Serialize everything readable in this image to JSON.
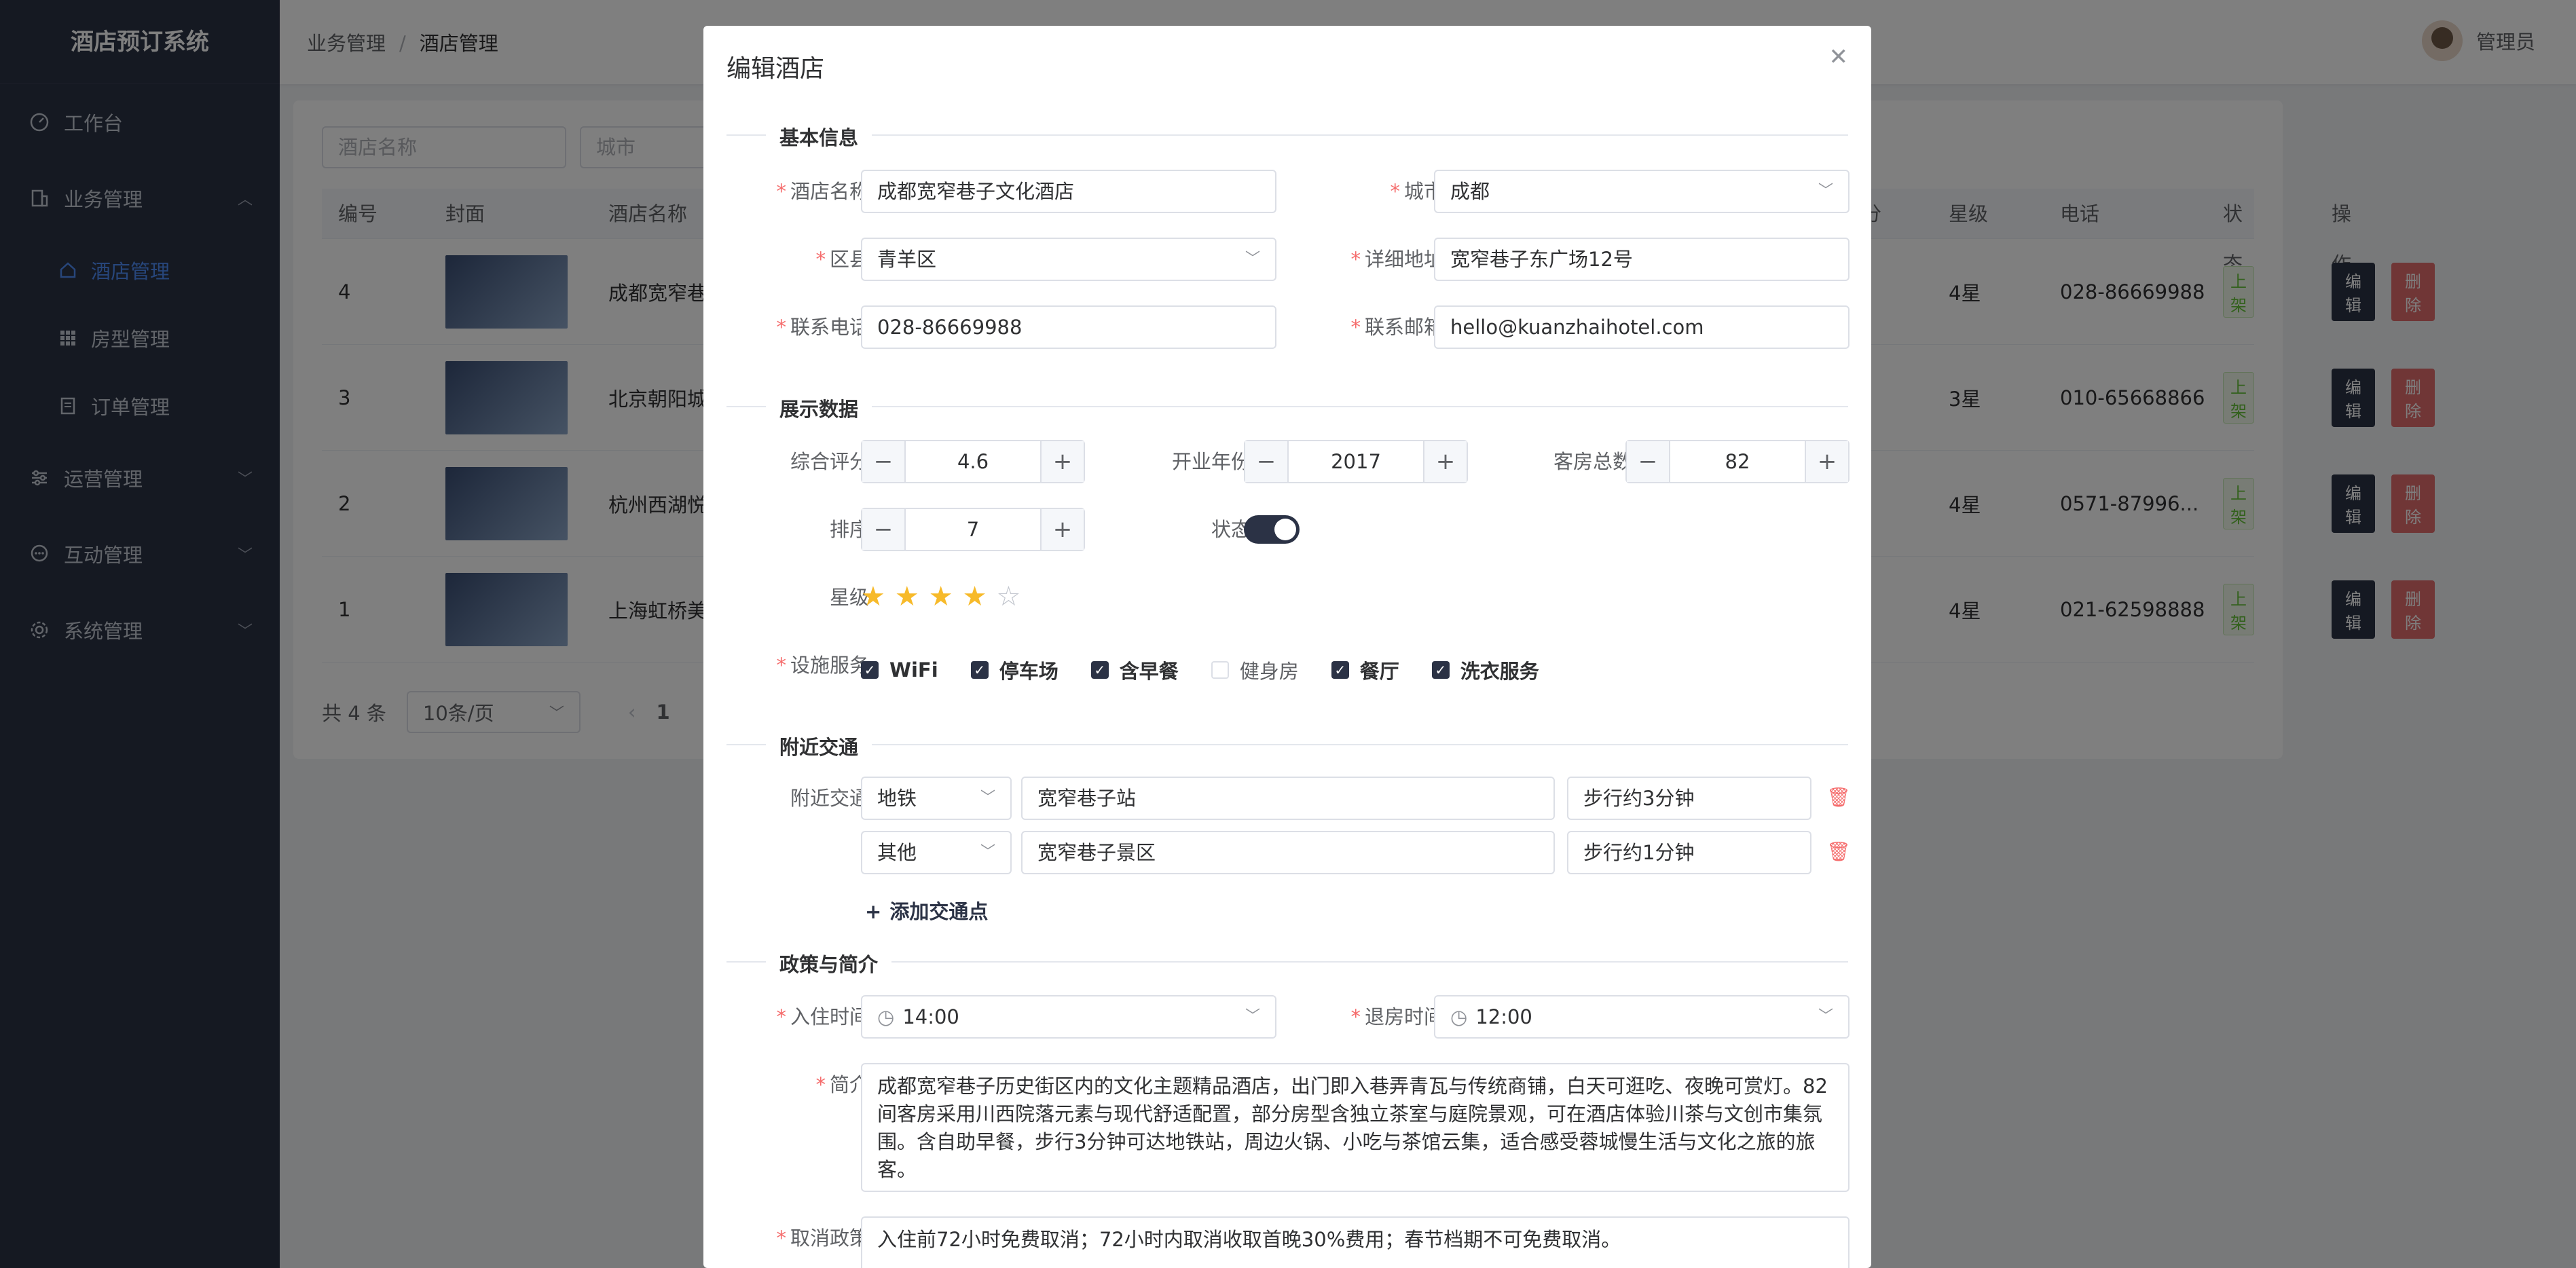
{
  "app": {
    "title": "酒店预订系统"
  },
  "sidebar": {
    "items": [
      {
        "label": "工作台"
      },
      {
        "label": "业务管理"
      },
      {
        "label": "酒店管理"
      },
      {
        "label": "房型管理"
      },
      {
        "label": "订单管理"
      },
      {
        "label": "运营管理"
      },
      {
        "label": "互动管理"
      },
      {
        "label": "系统管理"
      }
    ]
  },
  "header": {
    "breadcrumb": [
      "业务管理",
      "酒店管理"
    ],
    "user": "管理员"
  },
  "filters": {
    "name_placeholder": "酒店名称",
    "city_placeholder": "城市"
  },
  "table": {
    "columns": [
      "编号",
      "封面",
      "酒店名称",
      "分",
      "星级",
      "电话",
      "状态",
      "操作"
    ],
    "rows": [
      {
        "id": "4",
        "name": "成都宽窄巷",
        "star": "4星",
        "phone": "028-86669988",
        "status": "上架"
      },
      {
        "id": "3",
        "name": "北京朝阳城",
        "star": "3星",
        "phone": "010-65668866",
        "status": "上架"
      },
      {
        "id": "2",
        "name": "杭州西湖悦",
        "star": "4星",
        "phone": "0571-87996...",
        "status": "上架"
      },
      {
        "id": "1",
        "name": "上海虹桥美",
        "star": "4星",
        "phone": "021-62598888",
        "status": "上架"
      }
    ],
    "edit_label": "编辑",
    "delete_label": "删除"
  },
  "pagination": {
    "total": "共 4 条",
    "page_size": "10条/页",
    "current": "1"
  },
  "dialog": {
    "title": "编辑酒店",
    "sections": {
      "basic": "基本信息",
      "display": "展示数据",
      "transport": "附近交通",
      "policy": "政策与简介"
    },
    "fields": {
      "name_label": "酒店名称",
      "name": "成都宽窄巷子文化酒店",
      "city_label": "城市",
      "city": "成都",
      "district_label": "区县",
      "district": "青羊区",
      "address_label": "详细地址",
      "address": "宽窄巷子东广场12号",
      "phone_label": "联系电话",
      "phone": "028-86669988",
      "email_label": "联系邮箱",
      "email": "hello@kuanzhaihotel.com",
      "score_label": "综合评分",
      "score": "4.6",
      "year_label": "开业年份",
      "year": "2017",
      "rooms_label": "客房总数",
      "rooms": "82",
      "sort_label": "排序",
      "sort": "7",
      "status_label": "状态",
      "star_label": "星级",
      "facilities_label": "设施服务",
      "transport_label": "附近交通",
      "checkin_label": "入住时间",
      "checkin": "14:00",
      "checkout_label": "退房时间",
      "checkout": "12:00",
      "intro_label": "简介",
      "intro": "成都宽窄巷子历史街区内的文化主题精品酒店，出门即入巷弄青瓦与传统商铺，白天可逛吃、夜晚可赏灯。82间客房采用川西院落元素与现代舒适配置，部分房型含独立茶室与庭院景观，可在酒店体验川茶与文创市集氛围。含自助早餐，步行3分钟可达地铁站，周边火锅、小吃与茶馆云集，适合感受蓉城慢生活与文化之旅的旅客。",
      "cancel_label": "取消政策",
      "cancel": "入住前72小时免费取消；72小时内取消收取首晚30%费用；春节档期不可免费取消。"
    },
    "rating": 4,
    "rating_max": 5,
    "switch_on": true,
    "facilities": [
      {
        "label": "WiFi",
        "checked": true
      },
      {
        "label": "停车场",
        "checked": true
      },
      {
        "label": "含早餐",
        "checked": true
      },
      {
        "label": "健身房",
        "checked": false
      },
      {
        "label": "餐厅",
        "checked": true
      },
      {
        "label": "洗衣服务",
        "checked": true
      }
    ],
    "transport": [
      {
        "type": "地铁",
        "name": "宽窄巷子站",
        "distance": "步行约3分钟"
      },
      {
        "type": "其他",
        "name": "宽窄巷子景区",
        "distance": "步行约1分钟"
      }
    ],
    "add_transport": "添加交通点"
  },
  "colors": {
    "sidebar_bg": "#2b3245",
    "accent": "#4e8cf7",
    "danger": "#e06c6c",
    "success": "#67c23a"
  }
}
